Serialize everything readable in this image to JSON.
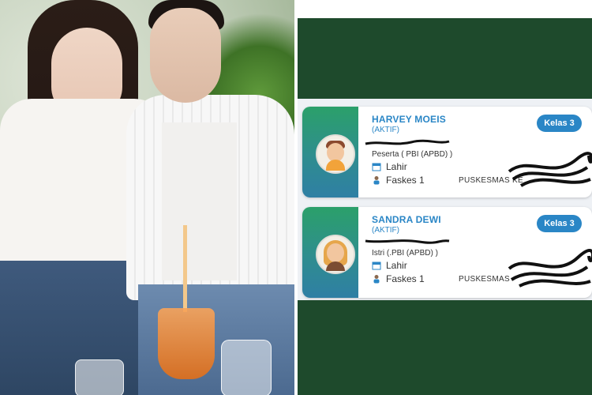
{
  "photo": {
    "description_icon": "couple-photo"
  },
  "cards": [
    {
      "name": "HARVEY MOEIS",
      "status": "(AKTIF)",
      "class_badge": "Kelas 3",
      "role": "Peserta",
      "type": "( PBI (APBD) )",
      "lahir_label": "Lahir",
      "faskes_label": "Faskes 1",
      "puskesmas_text": "PUSKESMAS KE",
      "avatar_icon": "male-avatar-icon"
    },
    {
      "name": "SANDRA DEWI",
      "status": "(AKTIF)",
      "class_badge": "Kelas 3",
      "role": "Istri",
      "type": "(.PBI (APBD) )",
      "lahir_label": "Lahir",
      "faskes_label": "Faskes 1",
      "puskesmas_text": "PUSKESMAS",
      "avatar_icon": "female-avatar-icon"
    }
  ],
  "colors": {
    "panel_green": "#1e4a2c",
    "accent_blue": "#2a86c6",
    "card_sidebar_start": "#2ba06a",
    "card_sidebar_end": "#2f7fa4"
  }
}
